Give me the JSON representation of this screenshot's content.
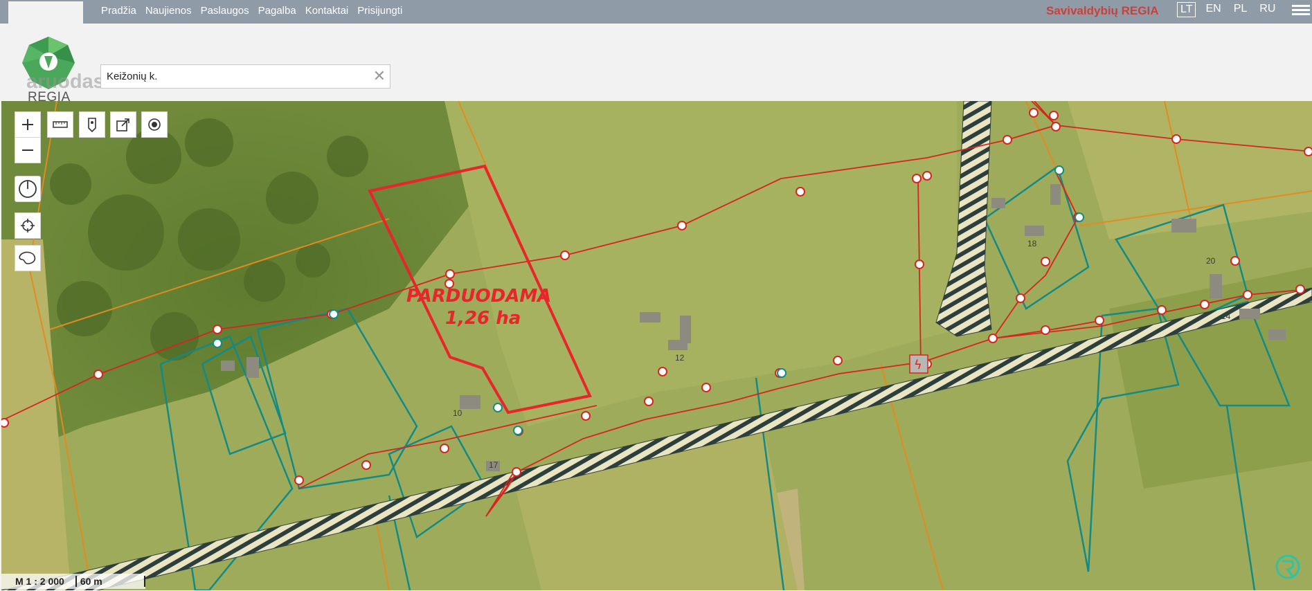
{
  "nav": {
    "items": [
      "Pradžia",
      "Naujienos",
      "Paslaugos",
      "Pagalba",
      "Kontaktai",
      "Prisijungti"
    ]
  },
  "brand": "Savivaldybių REGIA",
  "langs": [
    "LT",
    "EN",
    "PL",
    "RU"
  ],
  "active_lang": "LT",
  "logo": {
    "text": "REGIA",
    "watermark": "aruodas"
  },
  "search": {
    "value": "Keižonių k.",
    "clear_icon": "close-icon"
  },
  "map": {
    "label_line1": "PARDUODAMA",
    "label_line2": "1,26 ha",
    "house_numbers": [
      "10",
      "12",
      "17",
      "18",
      "20",
      "14"
    ],
    "tools": [
      "zoom-in-icon",
      "zoom-out-icon",
      "measure-icon",
      "marker-icon",
      "export-icon",
      "layer-point-icon",
      "compass-icon",
      "locate-icon",
      "area-icon"
    ]
  },
  "scale": {
    "ratio": "M 1 : 2 000",
    "distance": "60 m"
  },
  "colors": {
    "parcel_highlight": "#e8252a",
    "power_line": "#d7241f",
    "boundary_teal": "#128a86",
    "boundary_orange": "#e28b1e",
    "brand": "#c9413c"
  }
}
